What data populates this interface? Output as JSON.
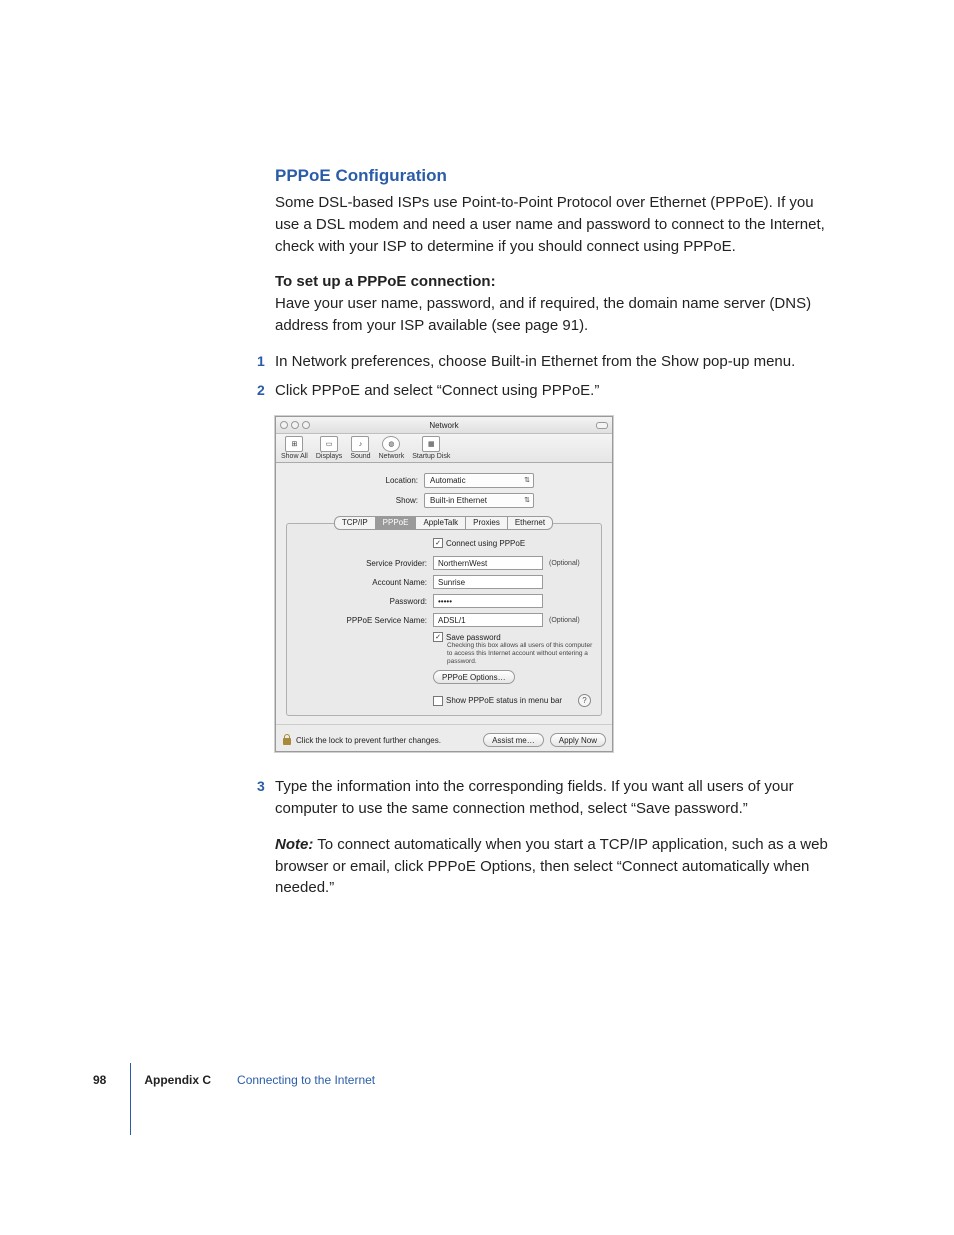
{
  "heading": "PPPoE Configuration",
  "intro": "Some DSL-based ISPs use Point-to-Point Protocol over Ethernet (PPPoE). If you use a DSL modem and need a user name and password to connect to the Internet, check with your ISP to determine if you should connect using PPPoE.",
  "setup_bold": "To set up a PPPoE connection:",
  "setup_text": "Have your user name, password, and if required, the domain name server (DNS) address from your ISP available (see page 91).",
  "step1": "In Network preferences, choose Built-in Ethernet from the Show pop-up menu.",
  "step2": "Click PPPoE and select “Connect using PPPoE.”",
  "step3": "Type the information into the corresponding fields. If you want all users of your computer to use the same connection method, select “Save password.”",
  "note_label": "Note:",
  "note_text": "  To connect automatically when you start a TCP/IP application, such as a web browser or email, click PPPoE Options, then select “Connect automatically when needed.”",
  "n1": "1",
  "n2": "2",
  "n3": "3",
  "win": {
    "title": "Network",
    "tb": {
      "showall": "Show All",
      "displays": "Displays",
      "sound": "Sound",
      "network": "Network",
      "startup": "Startup Disk"
    },
    "loc_label": "Location:",
    "loc_value": "Automatic",
    "show_label": "Show:",
    "show_value": "Built-in Ethernet",
    "tabs": {
      "tcpip": "TCP/IP",
      "pppoe": "PPPoE",
      "appletalk": "AppleTalk",
      "proxies": "Proxies",
      "ethernet": "Ethernet"
    },
    "connect_chk": "Connect using PPPoE",
    "sp_label": "Service Provider:",
    "sp_value": "NorthernWest",
    "an_label": "Account Name:",
    "an_value": "Sunrise",
    "pw_label": "Password:",
    "pw_value": "•••••",
    "sn_label": "PPPoE Service Name:",
    "sn_value": "ADSL/1",
    "optional": "(Optional)",
    "save_chk": "Save password",
    "save_note": "Checking this box allows all users of this computer to access this Internet account without entering a password.",
    "options_btn": "PPPoE Options…",
    "status_chk": "Show PPPoE status in menu bar",
    "help": "?",
    "lock_text": "Click the lock to prevent further changes.",
    "assist_btn": "Assist me…",
    "apply_btn": "Apply Now"
  },
  "footer": {
    "page": "98",
    "appendix": "Appendix C",
    "title": "Connecting to the Internet"
  }
}
